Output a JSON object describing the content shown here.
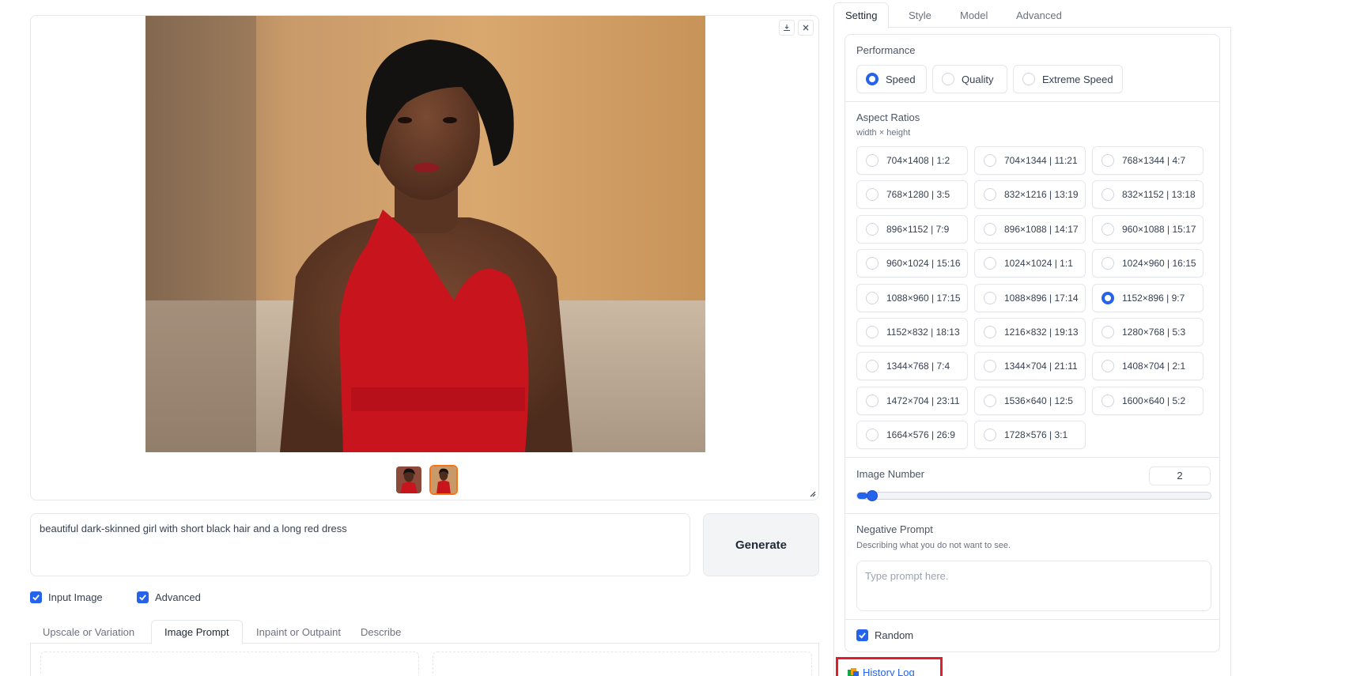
{
  "gallery": {
    "download_icon": "download-icon",
    "close_icon": "close-icon",
    "thumbnails": [
      {
        "label": "thumbnail-1",
        "selected": false
      },
      {
        "label": "thumbnail-2",
        "selected": true
      }
    ]
  },
  "prompt": {
    "value": "beautiful dark-skinned girl with short black hair and a long red dress"
  },
  "generate_label": "Generate",
  "options": {
    "input_image_label": "Input Image",
    "advanced_label": "Advanced"
  },
  "left_tabs": [
    {
      "label": "Upscale or Variation",
      "active": false
    },
    {
      "label": "Image Prompt",
      "active": true
    },
    {
      "label": "Inpaint or Outpaint",
      "active": false
    },
    {
      "label": "Describe",
      "active": false
    }
  ],
  "right_tabs": [
    {
      "label": "Setting",
      "active": true
    },
    {
      "label": "Style",
      "active": false
    },
    {
      "label": "Model",
      "active": false
    },
    {
      "label": "Advanced",
      "active": false
    }
  ],
  "performance": {
    "label": "Performance",
    "options": [
      "Speed",
      "Quality",
      "Extreme Speed"
    ],
    "selected": "Speed"
  },
  "aspect_ratios": {
    "label": "Aspect Ratios",
    "sublabel": "width × height",
    "options": [
      "704×1408 | 1:2",
      "704×1344 | 11:21",
      "768×1344 | 4:7",
      "768×1280 | 3:5",
      "832×1216 | 13:19",
      "832×1152 | 13:18",
      "896×1152 | 7:9",
      "896×1088 | 14:17",
      "960×1088 | 15:17",
      "960×1024 | 15:16",
      "1024×1024 | 1:1",
      "1024×960 | 16:15",
      "1088×960 | 17:15",
      "1088×896 | 17:14",
      "1152×896 | 9:7",
      "1152×832 | 18:13",
      "1216×832 | 19:13",
      "1280×768 | 5:3",
      "1344×768 | 7:4",
      "1344×704 | 21:11",
      "1408×704 | 2:1",
      "1472×704 | 23:11",
      "1536×640 | 12:5",
      "1600×640 | 5:2",
      "1664×576 | 26:9",
      "1728×576 | 3:1"
    ],
    "selected": "1152×896 | 9:7"
  },
  "image_number": {
    "label": "Image Number",
    "value": "2",
    "fraction": 0.03
  },
  "negative_prompt": {
    "label": "Negative Prompt",
    "sublabel": "Describing what you do not want to see.",
    "placeholder": "Type prompt here."
  },
  "random_label": "Random",
  "history_log_label": "History Log",
  "colors": {
    "accent": "#2563eb",
    "highlight_box": "#e11d2e",
    "selected_thumb_border": "#f97316"
  }
}
